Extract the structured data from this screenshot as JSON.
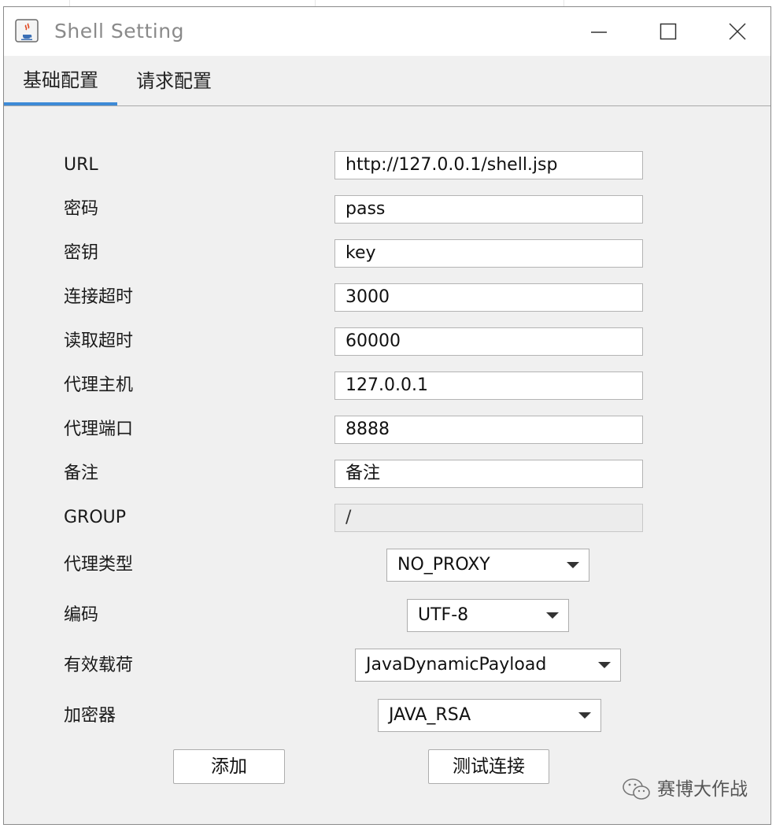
{
  "window": {
    "title": "Shell Setting"
  },
  "tabs": [
    {
      "label": "基础配置",
      "active": true
    },
    {
      "label": "请求配置",
      "active": false
    }
  ],
  "form": {
    "fields": [
      {
        "label": "URL",
        "value": "http://127.0.0.1/shell.jsp"
      },
      {
        "label": "密码",
        "value": "pass"
      },
      {
        "label": "密钥",
        "value": "key"
      },
      {
        "label": "连接超时",
        "value": "3000"
      },
      {
        "label": "读取超时",
        "value": "60000"
      },
      {
        "label": "代理主机",
        "value": "127.0.0.1"
      },
      {
        "label": "代理端口",
        "value": "8888"
      },
      {
        "label": "备注",
        "value": "备注"
      },
      {
        "label": "GROUP",
        "value": "/",
        "disabled": true
      }
    ],
    "selects": [
      {
        "label": "代理类型",
        "value": "NO_PROXY"
      },
      {
        "label": "编码",
        "value": "UTF-8"
      },
      {
        "label": "有效载荷",
        "value": "JavaDynamicPayload"
      },
      {
        "label": "加密器",
        "value": "JAVA_RSA"
      }
    ]
  },
  "buttons": {
    "add": "添加",
    "test": "测试连接"
  },
  "watermark": {
    "text": "赛博大作战"
  },
  "colors": {
    "tab_accent": "#3d8ad6",
    "window_bg": "#f0f0f0",
    "title_text": "#8a8a8a"
  }
}
